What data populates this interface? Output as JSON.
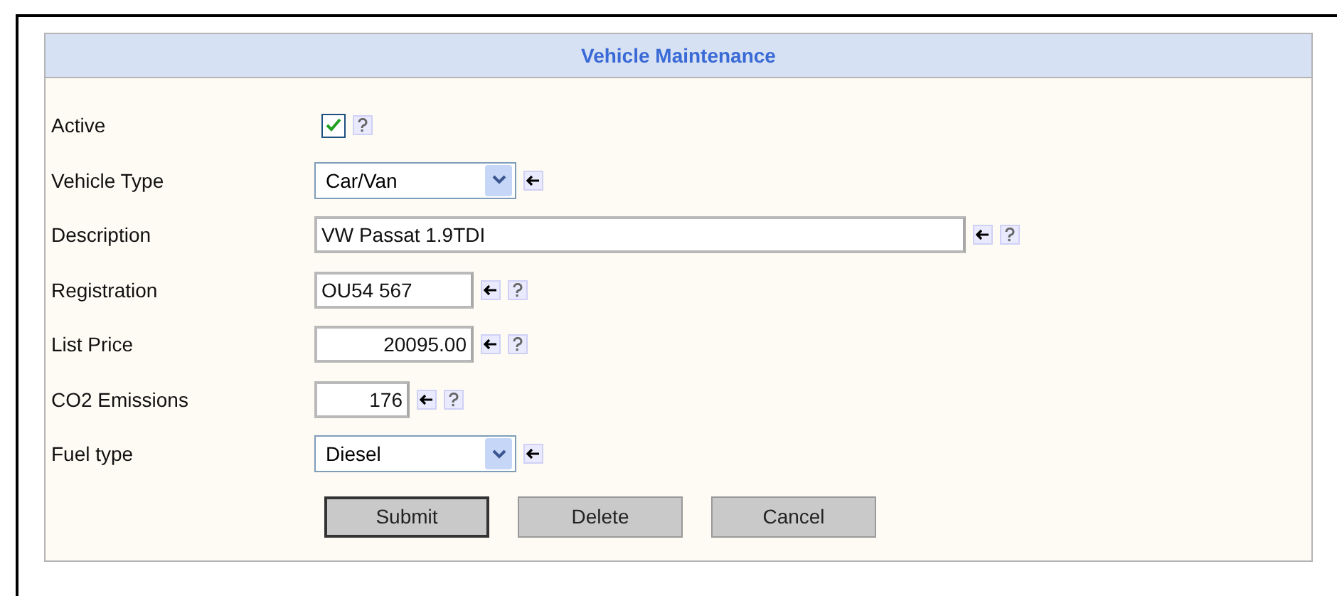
{
  "panel": {
    "title": "Vehicle Maintenance"
  },
  "fields": [
    {
      "kind": "checkbox",
      "label": "Active",
      "checked": true,
      "arrow": false,
      "help": true
    },
    {
      "kind": "select",
      "label": "Vehicle Type",
      "value": "Car/Van",
      "arrow": true,
      "help": false
    },
    {
      "kind": "widetext",
      "label": "Description",
      "value": "VW Passat 1.9TDI",
      "arrow": true,
      "help": true
    },
    {
      "kind": "text",
      "label": "Registration",
      "value": "OU54 567",
      "arrow": true,
      "help": true
    },
    {
      "kind": "amount",
      "label": "List Price",
      "value": "20095.00",
      "arrow": true,
      "help": true
    },
    {
      "kind": "number",
      "label": "CO2 Emissions",
      "value": "176",
      "arrow": true,
      "help": true
    },
    {
      "kind": "select",
      "label": "Fuel type",
      "value": "Diesel",
      "arrow": true,
      "help": false
    }
  ],
  "buttons": [
    {
      "label": "Submit",
      "focused": true
    },
    {
      "label": "Delete",
      "focused": false
    },
    {
      "label": "Cancel",
      "focused": false
    }
  ]
}
